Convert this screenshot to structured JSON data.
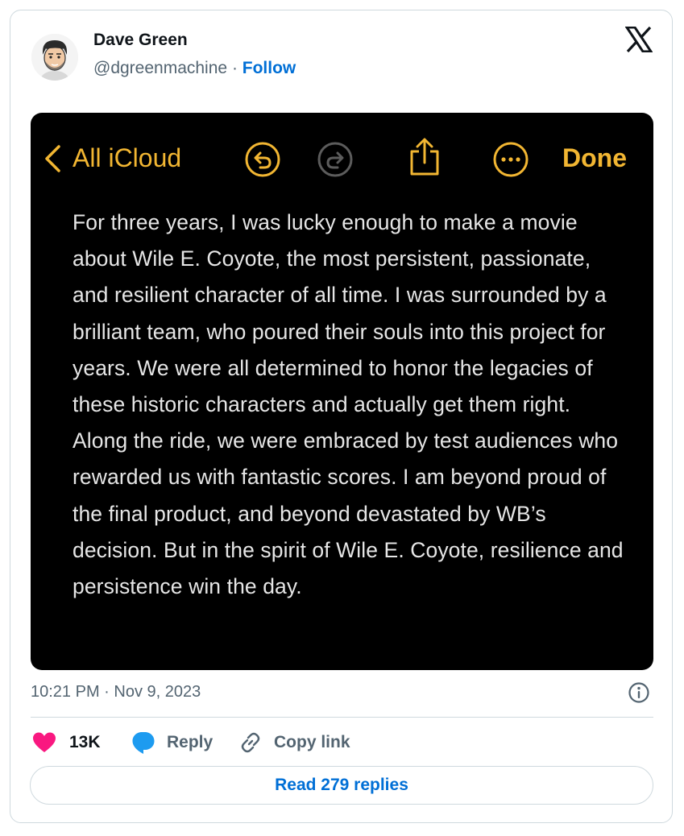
{
  "author": {
    "name": "Dave Green",
    "handle": "@dgreenmachine",
    "separator": "·",
    "follow_label": "Follow"
  },
  "brand": {
    "logo_icon": "x-logo-icon"
  },
  "note_screenshot": {
    "back_label": "All iCloud",
    "done_label": "Done",
    "accent_color": "#f2b632",
    "icons": [
      "chevron-left-icon",
      "undo-icon",
      "redo-icon",
      "share-icon",
      "more-icon"
    ],
    "text": "For three years, I was lucky enough to make a movie about Wile E. Coyote, the most persistent, passionate, and resilient character of all time. I was surrounded by a brilliant team, who poured their souls into this project for years. We were all determined to honor the legacies of these historic characters and actually get them right. Along the ride, we were embraced by test audiences who rewarded us with fantastic scores. I am beyond proud of the final product, and beyond devastated by WB’s decision. But in the spirit of Wile E. Coyote, resilience and persistence win the day."
  },
  "meta": {
    "timestamp": "10:21 PM · Nov 9, 2023"
  },
  "actions": {
    "likes": "13K",
    "reply_label": "Reply",
    "copy_link_label": "Copy link"
  },
  "read_replies_label": "Read 279 replies",
  "colors": {
    "like": "#f91880",
    "reply": "#1d9bf0",
    "link": "#006fd6"
  }
}
